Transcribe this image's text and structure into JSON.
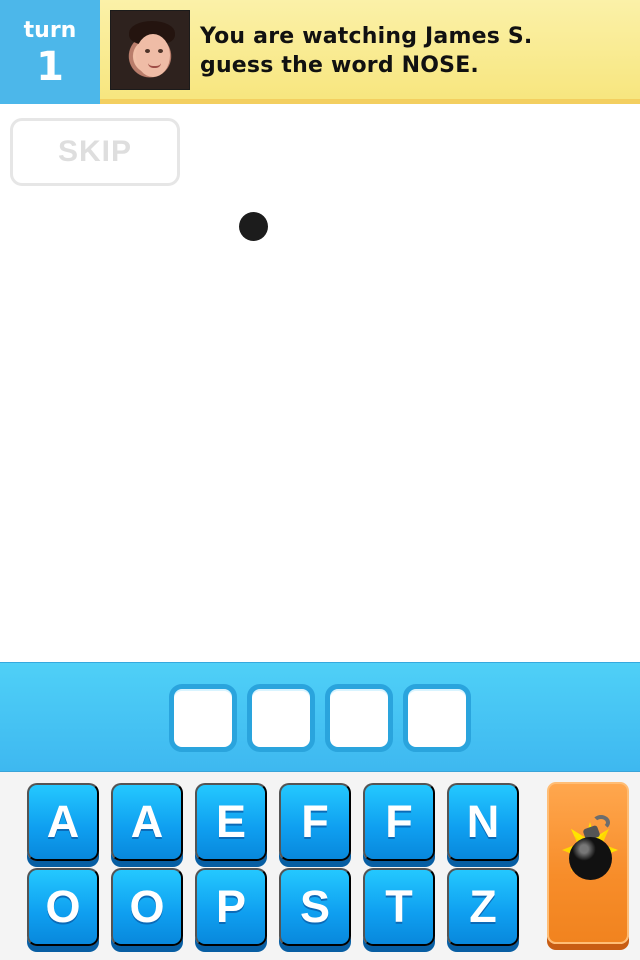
{
  "header": {
    "turn_label": "turn",
    "turn_number": "1",
    "message_line1": "You are watching James S.",
    "message_line2": "guess the word NOSE.",
    "avatar": "player-photo"
  },
  "drawing": {
    "skip_label": "SKIP"
  },
  "answer": {
    "slots": [
      "",
      "",
      "",
      ""
    ]
  },
  "keyboard": {
    "row1": [
      "A",
      "A",
      "E",
      "F",
      "F",
      "N"
    ],
    "row2": [
      "O",
      "O",
      "P",
      "S",
      "T",
      "Z"
    ],
    "bomb_icon": "bomb-icon"
  },
  "colors": {
    "turn_blue": "#4cb7ea",
    "banner_yellow": "#f7e67f",
    "key_blue": "#0f9ff0",
    "bomb_orange": "#f78d2a"
  }
}
